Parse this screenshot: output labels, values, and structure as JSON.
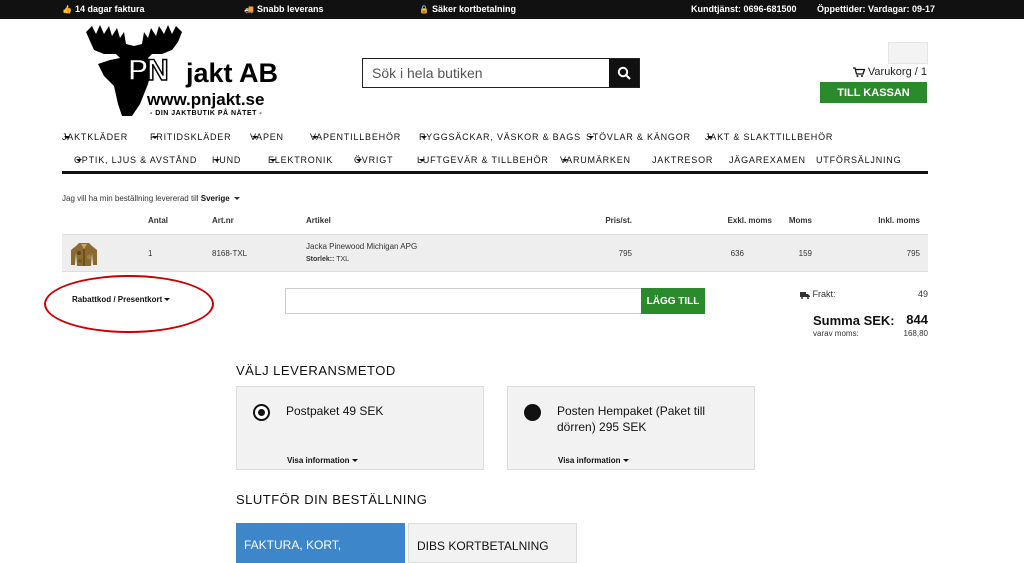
{
  "topbar": {
    "invoice": "14 dagar faktura",
    "delivery": "Snabb leverans",
    "secure": "Säker kortbetalning",
    "support": "Kundtjänst: 0696-681500",
    "hours": "Öppettider: Vardagar: 09-17"
  },
  "logo": {
    "pn": "PN",
    "name": "jakt AB",
    "url": "www.pnjakt.se",
    "tagline": "- DIN JAKTBUTIK PÅ NÄTET -"
  },
  "search": {
    "placeholder": "Sök i hela butiken"
  },
  "cart": {
    "label": "Varukorg / 1",
    "checkout": "TILL KASSAN"
  },
  "nav": {
    "row1": [
      "JAKTKLÄDER",
      "FRITIDSKLÄDER",
      "VAPEN",
      "VAPENTILLBEHÖR",
      "RYGGSÄCKAR, VÄSKOR & BAGS",
      "STÖVLAR & KÄNGOR",
      "JAKT & SLAKTTILLBEHÖR"
    ],
    "row2": [
      "OPTIK, LJUS & AVSTÅND",
      "HUND",
      "ELEKTRONIK",
      "ÖVRIGT",
      "LUFTGEVÄR & TILLBEHÖR",
      "VARUMÄRKEN",
      "JAKTRESOR",
      "JÄGAREXAMEN",
      "UTFÖRSÄLJNING"
    ]
  },
  "country": {
    "text": "Jag vill ha min beställning levererad till",
    "value": "Sverige"
  },
  "table": {
    "headers": {
      "qty": "Antal",
      "artnr": "Art.nr",
      "article": "Artikel",
      "price": "Pris/st.",
      "excl": "Exkl. moms",
      "vat": "Moms",
      "incl": "Inkl. moms"
    },
    "rows": [
      {
        "qty": "1",
        "artnr": "8168-TXL",
        "name": "Jacka Pinewood Michigan APG",
        "size_label": "Storlek::",
        "size": "TXL",
        "price": "795",
        "excl": "636",
        "vat": "159",
        "incl": "795"
      }
    ]
  },
  "coupon": {
    "label": "Rabattkod / Presentkort",
    "button": "LÄGG TILL"
  },
  "totals": {
    "frakt_label": "Frakt:",
    "frakt": "49",
    "sum_label": "Summa SEK:",
    "sum": "844",
    "vat_label": "varav moms:",
    "vat": "168,80"
  },
  "shipping": {
    "heading": "VÄLJ LEVERANSMETOD",
    "options": [
      {
        "label": "Postpaket 49 SEK",
        "info": "Visa information",
        "selected": true
      },
      {
        "label": "Posten Hempaket (Paket till dörren) 295 SEK",
        "info": "Visa information",
        "selected": false
      }
    ]
  },
  "payment": {
    "heading": "SLUTFÖR DIN BESTÄLLNING",
    "tabs": [
      "FAKTURA, KORT,",
      "DIBS KORTBETALNING"
    ]
  },
  "colors": {
    "green": "#2b8a2b",
    "blue": "#3d86c9",
    "annotation": "#cc0000"
  }
}
